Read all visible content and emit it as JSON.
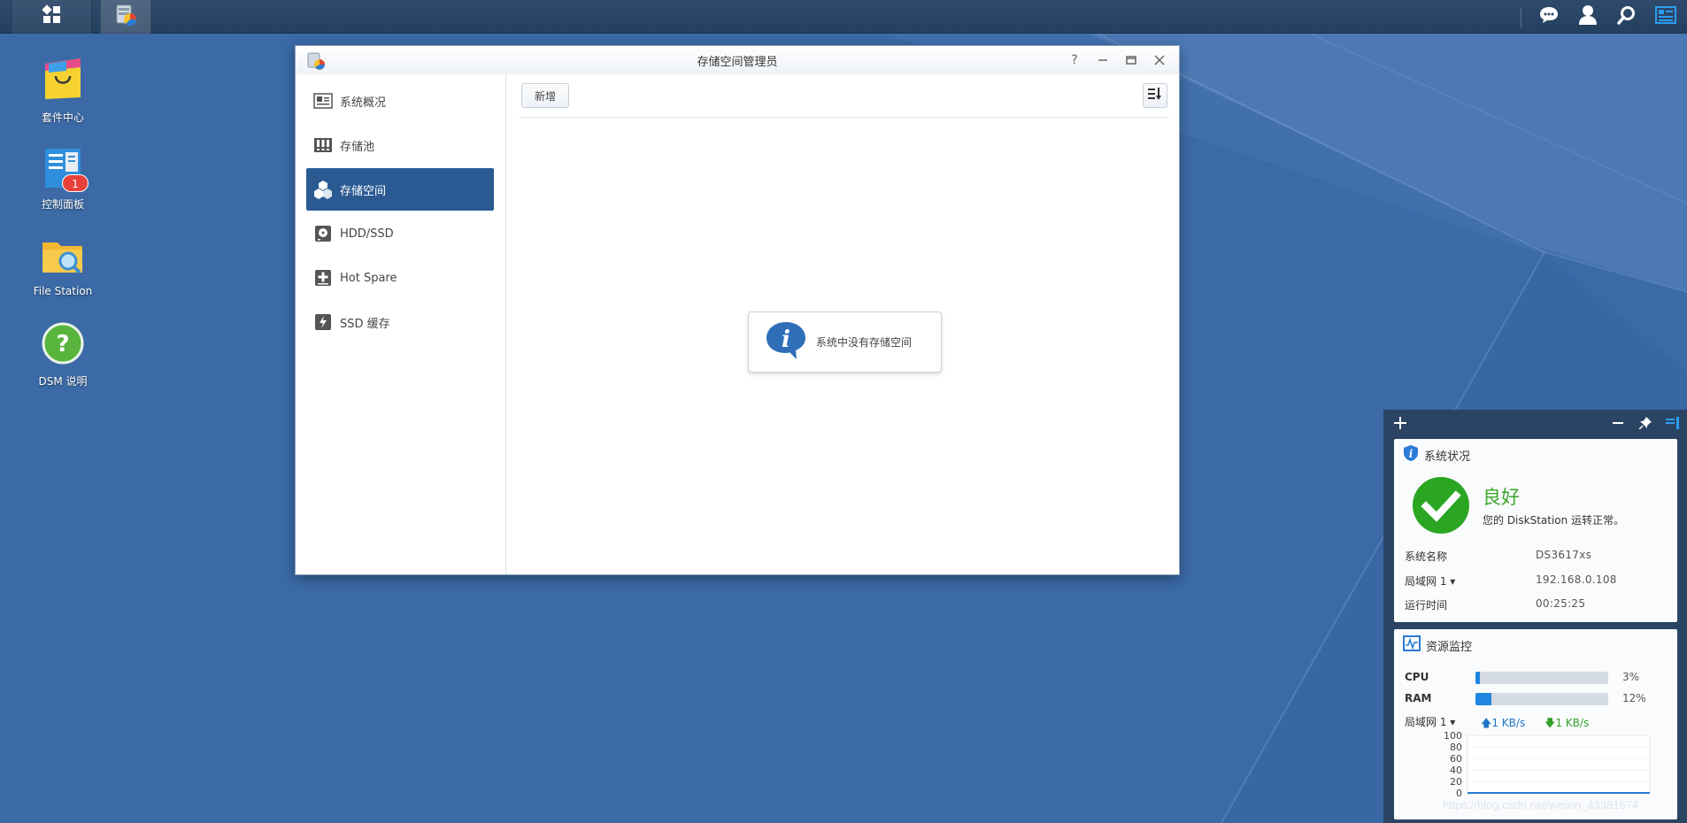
{
  "desktop": {
    "icons": [
      {
        "label": "套件中心"
      },
      {
        "label": "控制面板",
        "badge": "1"
      },
      {
        "label": "File Station"
      },
      {
        "label": "DSM 说明"
      }
    ]
  },
  "taskbar": {
    "left_icons": [
      "main-menu-icon",
      "storage-manager-icon"
    ],
    "right_icons": [
      "notification-icon",
      "user-icon",
      "search-icon",
      "widgets-icon"
    ]
  },
  "window": {
    "title": "存储空间管理员",
    "controls": [
      "help",
      "minimize",
      "maximize",
      "close"
    ],
    "sidebar": {
      "items": [
        {
          "label": "系统概况",
          "icon": "overview-icon"
        },
        {
          "label": "存储池",
          "icon": "storage-pool-icon"
        },
        {
          "label": "存储空间",
          "icon": "volume-icon",
          "active": true
        },
        {
          "label": "HDD/SSD",
          "icon": "disk-icon"
        },
        {
          "label": "Hot Spare",
          "icon": "hot-spare-icon"
        },
        {
          "label": "SSD 缓存",
          "icon": "ssd-cache-icon"
        }
      ]
    },
    "toolbar": {
      "add_label": "新增"
    },
    "empty_message": "系统中没有存储空间"
  },
  "widgets": {
    "system_status": {
      "title": "系统状况",
      "status": "良好",
      "description": "您的 DiskStation 运转正常。",
      "rows": [
        {
          "key": "系统名称",
          "value": "DS3617xs"
        },
        {
          "key": "局域网 1 ▾",
          "value": "192.168.0.108"
        },
        {
          "key": "运行时间",
          "value": "00:25:25"
        }
      ]
    },
    "resource_monitor": {
      "title": "资源监控",
      "cpu": {
        "label": "CPU",
        "value": "3%",
        "percent": 3
      },
      "ram": {
        "label": "RAM",
        "value": "12%",
        "percent": 12
      },
      "network": {
        "label": "局域网 1 ▾",
        "up": "1 KB/s",
        "down": "1 KB/s"
      },
      "chart_ticks": [
        "100",
        "80",
        "60",
        "40",
        "20",
        "0"
      ]
    }
  },
  "watermark": "https://blog.csdn.net/weixin_43381674"
}
